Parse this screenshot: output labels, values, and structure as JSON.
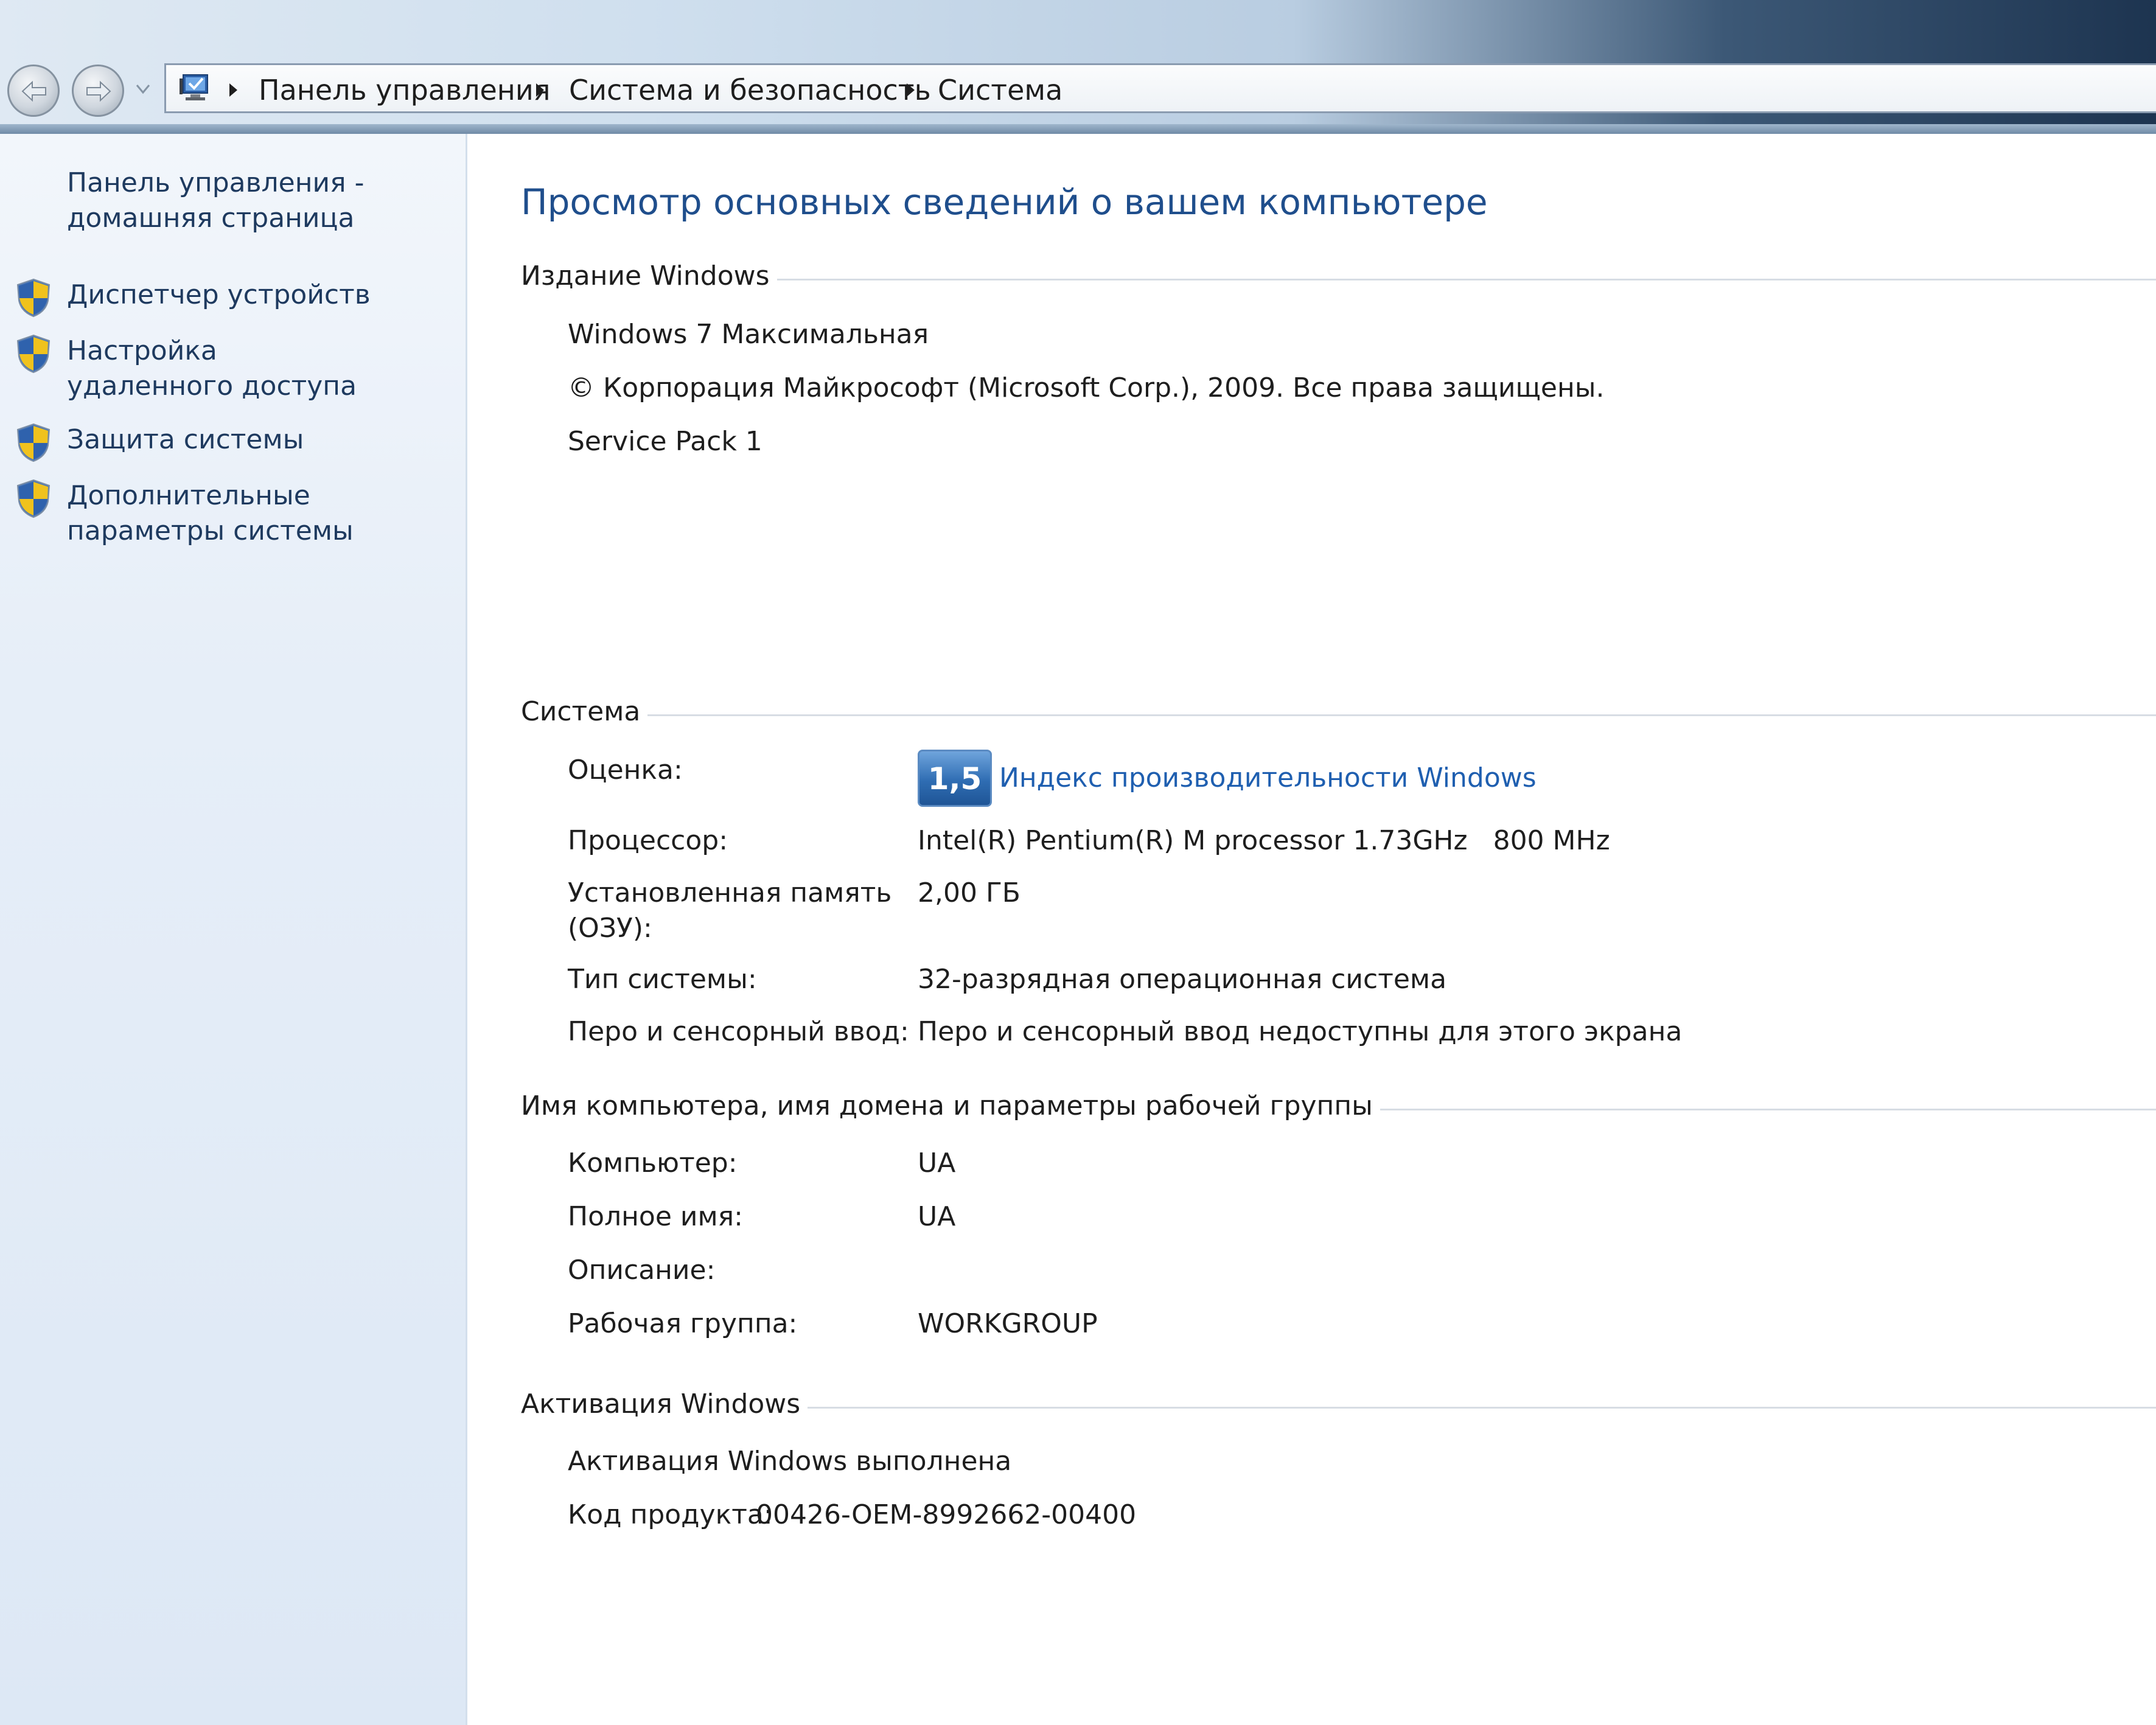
{
  "navigation": {
    "breadcrumbs": [
      "Панель управления",
      "Система и безопасность",
      "Система"
    ]
  },
  "tasks": {
    "home": "Панель управления - домашняя страница",
    "items": [
      {
        "label": "Диспетчер устройств",
        "icon": "uac-shield-icon"
      },
      {
        "label": "Настройка удаленного доступа",
        "icon": "uac-shield-icon"
      },
      {
        "label": "Защита системы",
        "icon": "uac-shield-icon"
      },
      {
        "label": "Дополнительные параметры системы",
        "icon": "uac-shield-icon"
      }
    ]
  },
  "content": {
    "title": "Просмотр основных сведений о вашем компьютере",
    "edition": {
      "heading": "Издание Windows",
      "name": "Windows 7 Максимальная",
      "copyright": "© Корпорация Майкрософт (Microsoft Corp.), 2009. Все права защищены.",
      "service_pack": "Service Pack 1"
    },
    "system": {
      "heading": "Система",
      "rating_label": "Оценка:",
      "rating_score": "1,5",
      "rating_link": "Индекс производительности Windows",
      "processor_label": "Процессор:",
      "processor_value": "Intel(R) Pentium(R) M processor 1.73GHz   800 MHz",
      "memory_label_1": "Установленная память",
      "memory_label_2": "(ОЗУ):",
      "memory_value": "2,00 ГБ",
      "type_label": "Тип системы:",
      "type_value": "32-разрядная операционная система",
      "pen_label": "Перо и сенсорный ввод:",
      "pen_value": "Перо и сенсорный ввод недоступны для этого экрана"
    },
    "computer_name": {
      "heading": "Имя компьютера, имя домена и параметры рабочей группы",
      "computer_label": "Компьютер:",
      "computer_value": "UA",
      "full_name_label": "Полное имя:",
      "full_name_value": "UA",
      "description_label": "Описание:",
      "description_value": "",
      "workgroup_label": "Рабочая группа:",
      "workgroup_value": "WORKGROUP"
    },
    "activation": {
      "heading": "Активация Windows",
      "status": "Активация Windows выполнена",
      "product_key_label": "Код продукта:",
      "product_key_value": "00426-OEM-8992662-00400"
    }
  },
  "colors": {
    "link": "#1f5fb0",
    "title": "#1f4e8c",
    "accent_bar": "#1d3450"
  }
}
